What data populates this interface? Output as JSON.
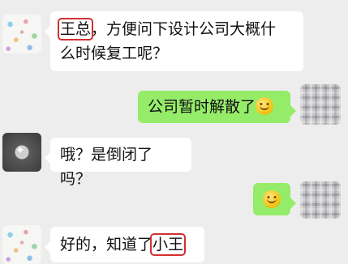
{
  "messages": [
    {
      "side": "left",
      "parts": [
        "王总",
        "，方便问下设计公司大概什",
        "么时候复工呢？"
      ]
    },
    {
      "side": "right",
      "text": "公司暂时解散了",
      "emoji": "smile"
    },
    {
      "side": "left",
      "text": "哦？是倒闭了吗？"
    },
    {
      "side": "right",
      "emoji": "smile"
    },
    {
      "side": "left",
      "parts": [
        "好的，知道了",
        "小王"
      ]
    }
  ],
  "avatars": [
    "dots-avatar",
    "pixelated-avatar",
    "dark-avatar",
    "pixelated-avatar",
    "dots-avatar"
  ],
  "colors": {
    "background": "#ededed",
    "bubble_left": "#ffffff",
    "bubble_right": "#95ec69",
    "highlight": "#d23030"
  }
}
